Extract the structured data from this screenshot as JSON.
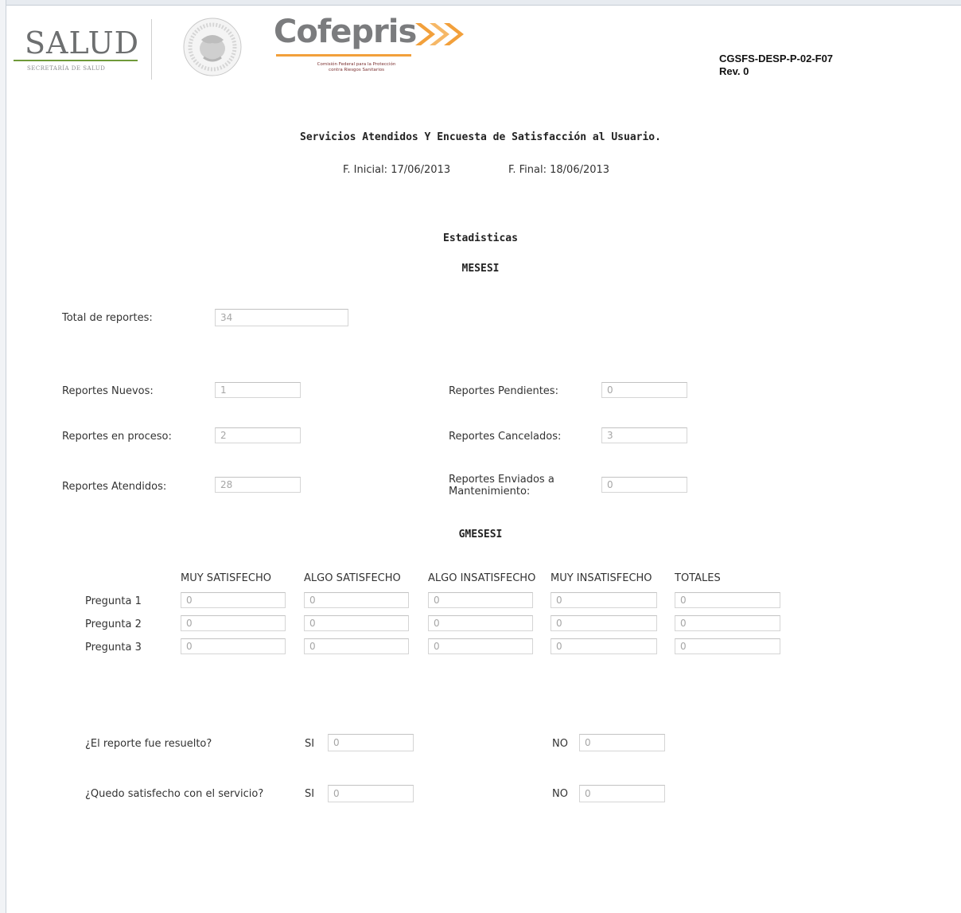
{
  "header": {
    "salud_logo_text": "SALUD",
    "salud_logo_subtitle": "SECRETARÍA DE SALUD",
    "cofepris_logo_text": "Cofepris",
    "cofepris_tagline_line1": "Comisión Federal para la Protección",
    "cofepris_tagline_line2": "contra Riesgos Sanitarios",
    "doc_code": "CGSFS-DESP-P-02-F07",
    "revision": "Rev. 0",
    "colors": {
      "salud_green": "#6f9a3a",
      "cofepris_orange": "#f2a03b",
      "logo_gray": "#7b7c7e"
    }
  },
  "report": {
    "title": "Servicios Atendidos Y Encuesta de Satisfacción al Usuario.",
    "start_date": "F. Inicial: 17/06/2013",
    "end_date": "F. Final: 18/06/2013"
  },
  "stats": {
    "section_title": "Estadisticas",
    "group_title": "MESESI",
    "total_label": "Total de reportes:",
    "total_value": "34",
    "items": [
      {
        "label": "Reportes Nuevos:",
        "value": "1"
      },
      {
        "label": "Reportes Pendientes:",
        "value": "0"
      },
      {
        "label": "Reportes en proceso:",
        "value": "2"
      },
      {
        "label": "Reportes Cancelados:",
        "value": "3"
      },
      {
        "label": "Reportes Atendidos:",
        "value": "28"
      },
      {
        "label": "Reportes Enviados a Mantenimiento:",
        "value": "0"
      }
    ]
  },
  "survey": {
    "group_title": "GMESESI",
    "columns": [
      "MUY SATISFECHO",
      "ALGO SATISFECHO",
      "ALGO INSATISFECHO",
      "MUY INSATISFECHO",
      "TOTALES"
    ],
    "rows": [
      {
        "label": "Pregunta 1",
        "values": [
          "0",
          "0",
          "0",
          "0",
          "0"
        ]
      },
      {
        "label": "Pregunta 2",
        "values": [
          "0",
          "0",
          "0",
          "0",
          "0"
        ]
      },
      {
        "label": "Pregunta 3",
        "values": [
          "0",
          "0",
          "0",
          "0",
          "0"
        ]
      }
    ]
  },
  "questions": [
    {
      "label": "¿El reporte fue resuelto?",
      "yes_label": "SI",
      "yes_value": "0",
      "no_label": "NO",
      "no_value": "0"
    },
    {
      "label": "¿Quedo satisfecho con el servicio?",
      "yes_label": "SI",
      "yes_value": "0",
      "no_label": "NO",
      "no_value": "0"
    }
  ]
}
